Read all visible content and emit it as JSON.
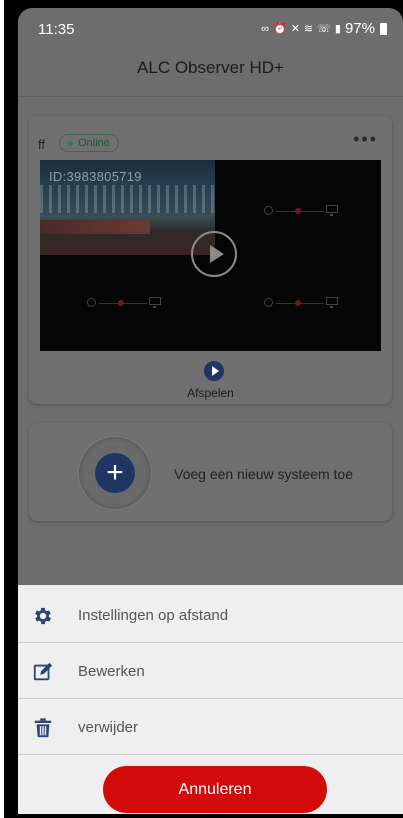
{
  "status_bar": {
    "time": "11:35",
    "icons": [
      "link-icon",
      "alarm-icon",
      "mute-icon",
      "wifi-icon",
      "wifi-call-icon",
      "signal-icon",
      "battery-icon"
    ],
    "battery_level": "97%"
  },
  "header": {
    "title": "ALC Observer HD+"
  },
  "device_card": {
    "name": "ff",
    "status": "Online",
    "status_color": "#2e7d46",
    "more_icon": "more-horizontal-icon",
    "thumbnail_id": "ID:3983805719",
    "play_label": "Afspelen",
    "accent_color": "#1f3563"
  },
  "add_card": {
    "label": "Voeg een nieuw systeem toe",
    "icon": "plus-icon"
  },
  "sheet": {
    "items": [
      {
        "label": "Instellingen op afstand",
        "icon": "gear-icon"
      },
      {
        "label": "Bewerken",
        "icon": "edit-icon"
      },
      {
        "label": "verwijder",
        "icon": "trash-icon"
      }
    ],
    "cancel_label": "Annuleren",
    "cancel_color": "#d30a0a"
  }
}
